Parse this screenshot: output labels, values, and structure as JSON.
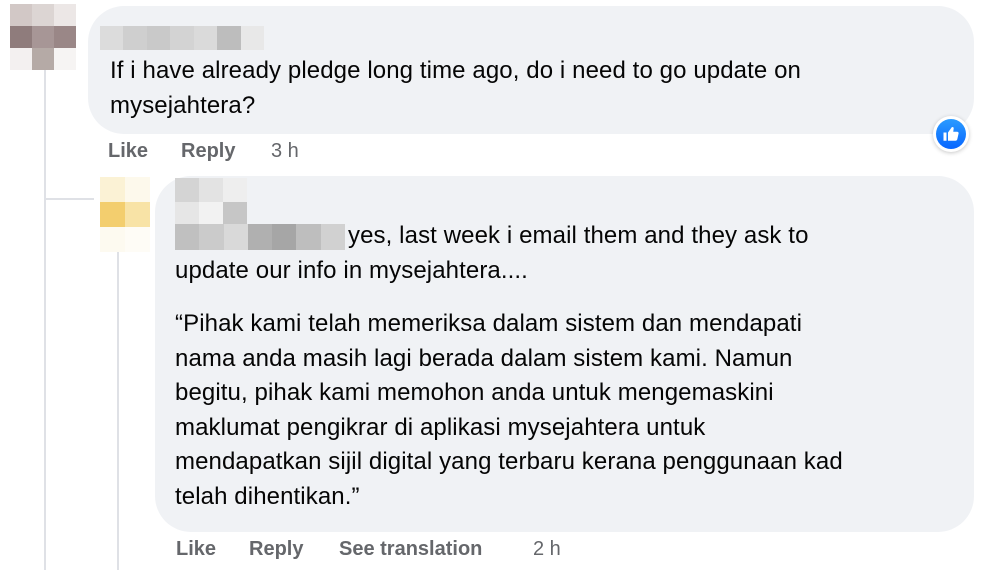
{
  "comments": [
    {
      "text": "If i have already pledge long time ago, do i need to go update on\nmysejahtera?",
      "actions": {
        "like": "Like",
        "reply": "Reply"
      },
      "time": "3 h",
      "reaction_icon": "thumbs-up-icon"
    },
    {
      "text_line1": "yes, last week i email them and they ask to",
      "text_line2": "update our info in mysejahtera....",
      "quote": "“Pihak kami telah memeriksa dalam sistem dan mendapati\nnama anda masih lagi berada dalam sistem kami. Namun\nbegitu, pihak kami memohon anda untuk mengemaskini\nmaklumat pengikrar di aplikasi mysejahtera untuk\nmendapatkan sijil digital yang terbaru kerana penggunaan kad\ntelah dihentikan.”",
      "actions": {
        "like": "Like",
        "reply": "Reply",
        "translate": "See translation"
      },
      "time": "2 h"
    }
  ],
  "colors": {
    "bubble": "#f0f2f5",
    "action_text": "#65676b",
    "like_blue": "#0866ff"
  }
}
